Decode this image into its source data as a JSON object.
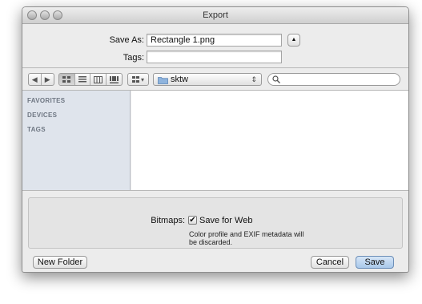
{
  "window": {
    "title": "Export"
  },
  "save_as": {
    "label": "Save As:",
    "value": "Rectangle 1.png"
  },
  "tags": {
    "label": "Tags:",
    "value": ""
  },
  "toolbar": {
    "back_glyph": "◀",
    "forward_glyph": "▶",
    "view_icons": [
      "icon-view",
      "list-view",
      "column-view",
      "coverflow-view"
    ],
    "arrange_glyph": "▾",
    "location": "sktw",
    "location_arrows": "⇕",
    "expand_glyph": "▲"
  },
  "sidebar": {
    "headings": [
      "FAVORITES",
      "DEVICES",
      "TAGS"
    ]
  },
  "accessory": {
    "bitmaps_label": "Bitmaps:",
    "save_for_web_label": "Save for Web",
    "checkmark": "✔",
    "note_line1": "Color profile and EXIF metadata will",
    "note_line2": "be discarded."
  },
  "buttons": {
    "new_folder": "New Folder",
    "cancel": "Cancel",
    "save": "Save"
  }
}
